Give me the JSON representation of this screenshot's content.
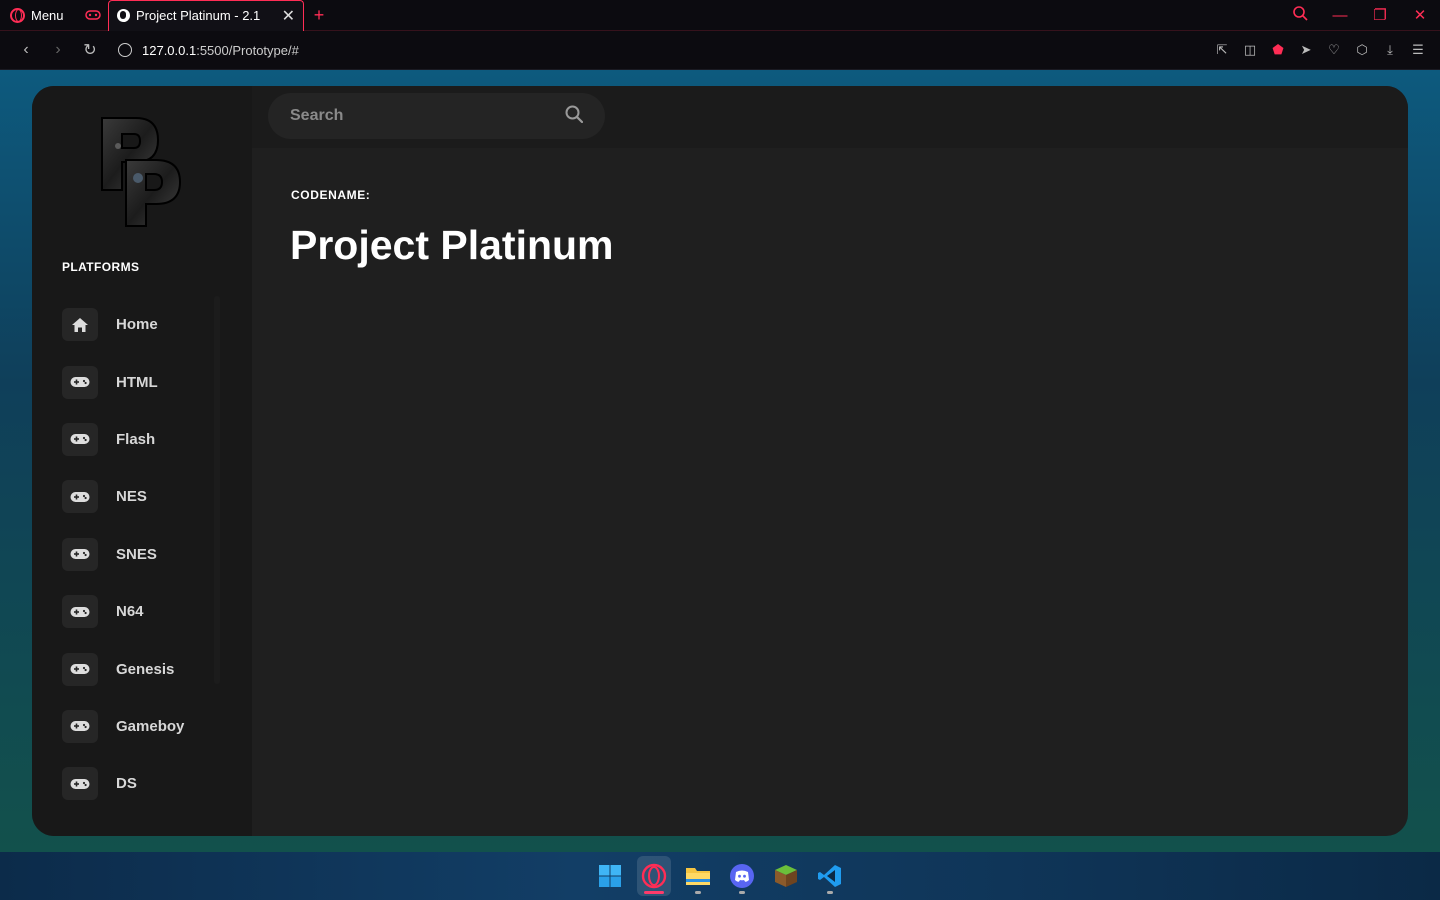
{
  "browser": {
    "menu_label": "Menu",
    "tab_title": "Project Platinum - 2.1",
    "url_host": "127.0.0.1",
    "url_path": ":5500/Prototype/#"
  },
  "app": {
    "search_placeholder": "Search",
    "platforms_heading": "PLATFORMS",
    "nav": [
      {
        "label": "Home",
        "icon": "home-icon"
      },
      {
        "label": "HTML",
        "icon": "gamepad-icon"
      },
      {
        "label": "Flash",
        "icon": "gamepad-icon"
      },
      {
        "label": "NES",
        "icon": "gamepad-icon"
      },
      {
        "label": "SNES",
        "icon": "gamepad-icon"
      },
      {
        "label": "N64",
        "icon": "gamepad-icon"
      },
      {
        "label": "Genesis",
        "icon": "gamepad-icon"
      },
      {
        "label": "Gameboy",
        "icon": "gamepad-icon"
      },
      {
        "label": "DS",
        "icon": "gamepad-icon"
      }
    ],
    "content": {
      "eyebrow": "CODENAME:",
      "title": "Project Platinum"
    }
  },
  "colors": {
    "accent": "#ff2d55",
    "sidebar_bg": "#181818",
    "main_bg": "#1f1f1f"
  },
  "taskbar": {
    "icons": [
      "windows-start-icon",
      "opera-gx-icon",
      "file-explorer-icon",
      "discord-icon",
      "minecraft-icon",
      "vscode-icon"
    ]
  }
}
